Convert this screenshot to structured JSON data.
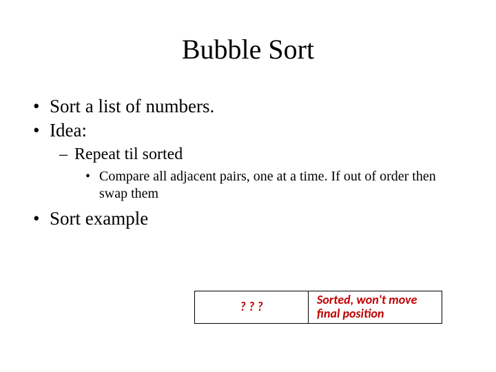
{
  "title": "Bubble Sort",
  "bullets": {
    "b1": "Sort a list of numbers.",
    "b2": "Idea:",
    "b2_1": "Repeat til sorted",
    "b2_1_1": "Compare all adjacent pairs, one at a time. If out of order then swap them",
    "b3": "Sort example"
  },
  "legend": {
    "q": "? ? ?",
    "sorted": "Sorted, won't move final position"
  }
}
